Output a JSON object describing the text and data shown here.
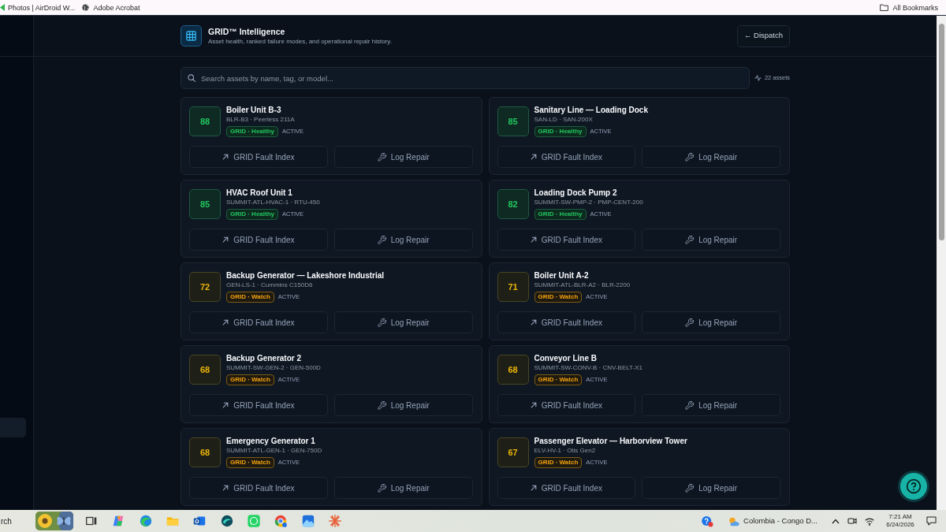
{
  "browser_bar": {
    "bookmarks": [
      {
        "label": "Photos | AirDroid W..."
      },
      {
        "label": "Adobe Acrobat"
      }
    ],
    "all_bookmarks": "All Bookmarks"
  },
  "header": {
    "title": "GRID™ Intelligence",
    "subtitle": "Asset health, ranked failure modes, and operational repair history.",
    "back_button": "← Dispatch"
  },
  "search": {
    "placeholder": "Search assets by name, tag, or model...",
    "asset_count": "22 assets"
  },
  "assets": [
    {
      "name": "Boiler Unit B-3",
      "meta": "BLR-B3 · Peerless 211A",
      "score": "88",
      "kind": "healthy",
      "badge": "GRID · Healthy",
      "state": "ACTIVE",
      "actions": [
        {
          "kind": "fault-index",
          "label": "GRID Fault Index"
        },
        {
          "kind": "log-repair",
          "label": "Log Repair"
        }
      ]
    },
    {
      "name": "Sanitary Line — Loading Dock",
      "meta": "SAN-LD · SAN-200X",
      "score": "85",
      "kind": "healthy",
      "badge": "GRID · Healthy",
      "state": "ACTIVE",
      "actions": [
        {
          "kind": "fault-index",
          "label": "GRID Fault Index"
        },
        {
          "kind": "log-repair",
          "label": "Log Repair"
        }
      ]
    },
    {
      "name": "HVAC Roof Unit 1",
      "meta": "SUMMIT-ATL-HVAC-1 · RTU-450",
      "score": "85",
      "kind": "healthy",
      "badge": "GRID · Healthy",
      "state": "ACTIVE",
      "actions": [
        {
          "kind": "fault-index",
          "label": "GRID Fault Index"
        },
        {
          "kind": "log-repair",
          "label": "Log Repair"
        }
      ]
    },
    {
      "name": "Loading Dock Pump 2",
      "meta": "SUMMIT-SW-PMP-2 · PMP-CENT-200",
      "score": "82",
      "kind": "healthy",
      "badge": "GRID · Healthy",
      "state": "ACTIVE",
      "actions": [
        {
          "kind": "fault-index",
          "label": "GRID Fault Index"
        },
        {
          "kind": "log-repair",
          "label": "Log Repair"
        }
      ]
    },
    {
      "name": "Backup Generator — Lakeshore Industrial",
      "meta": "GEN-LS-1 · Cummins C150D6",
      "score": "72",
      "kind": "watch",
      "badge": "GRID · Watch",
      "state": "ACTIVE",
      "actions": [
        {
          "kind": "fault-index",
          "label": "GRID Fault Index"
        },
        {
          "kind": "log-repair",
          "label": "Log Repair"
        }
      ]
    },
    {
      "name": "Boiler Unit A-2",
      "meta": "SUMMIT-ATL-BLR-A2 · BLR-2200",
      "score": "71",
      "kind": "watch",
      "badge": "GRID · Watch",
      "state": "ACTIVE",
      "actions": [
        {
          "kind": "fault-index",
          "label": "GRID Fault Index"
        },
        {
          "kind": "log-repair",
          "label": "Log Repair"
        }
      ]
    },
    {
      "name": "Backup Generator 2",
      "meta": "SUMMIT-SW-GEN-2 · GEN-500D",
      "score": "68",
      "kind": "watch",
      "badge": "GRID · Watch",
      "state": "ACTIVE",
      "actions": [
        {
          "kind": "fault-index",
          "label": "GRID Fault Index"
        },
        {
          "kind": "log-repair",
          "label": "Log Repair"
        }
      ]
    },
    {
      "name": "Conveyor Line B",
      "meta": "SUMMIT-SW-CONV-B · CNV-BELT-X1",
      "score": "68",
      "kind": "watch",
      "badge": "GRID · Watch",
      "state": "ACTIVE",
      "actions": [
        {
          "kind": "fault-index",
          "label": "GRID Fault Index"
        },
        {
          "kind": "log-repair",
          "label": "Log Repair"
        }
      ]
    },
    {
      "name": "Emergency Generator 1",
      "meta": "SUMMIT-ATL-GEN-1 · GEN-750D",
      "score": "68",
      "kind": "watch",
      "badge": "GRID · Watch",
      "state": "ACTIVE",
      "actions": [
        {
          "kind": "fault-index",
          "label": "GRID Fault Index"
        },
        {
          "kind": "log-repair",
          "label": "Log Repair"
        }
      ]
    },
    {
      "name": "Passenger Elevator — Harborview Tower",
      "meta": "ELV-HV-1 · Otis Gen2",
      "score": "67",
      "kind": "watch",
      "badge": "GRID · Watch",
      "state": "ACTIVE",
      "actions": [
        {
          "kind": "fault-index",
          "label": "GRID Fault Index"
        },
        {
          "kind": "log-repair",
          "label": "Log Repair"
        }
      ]
    }
  ],
  "taskbar": {
    "search_text": "rch",
    "weather": "Colombia - Congo D...",
    "time": "7:21 AM",
    "date": "6/24/2026"
  }
}
